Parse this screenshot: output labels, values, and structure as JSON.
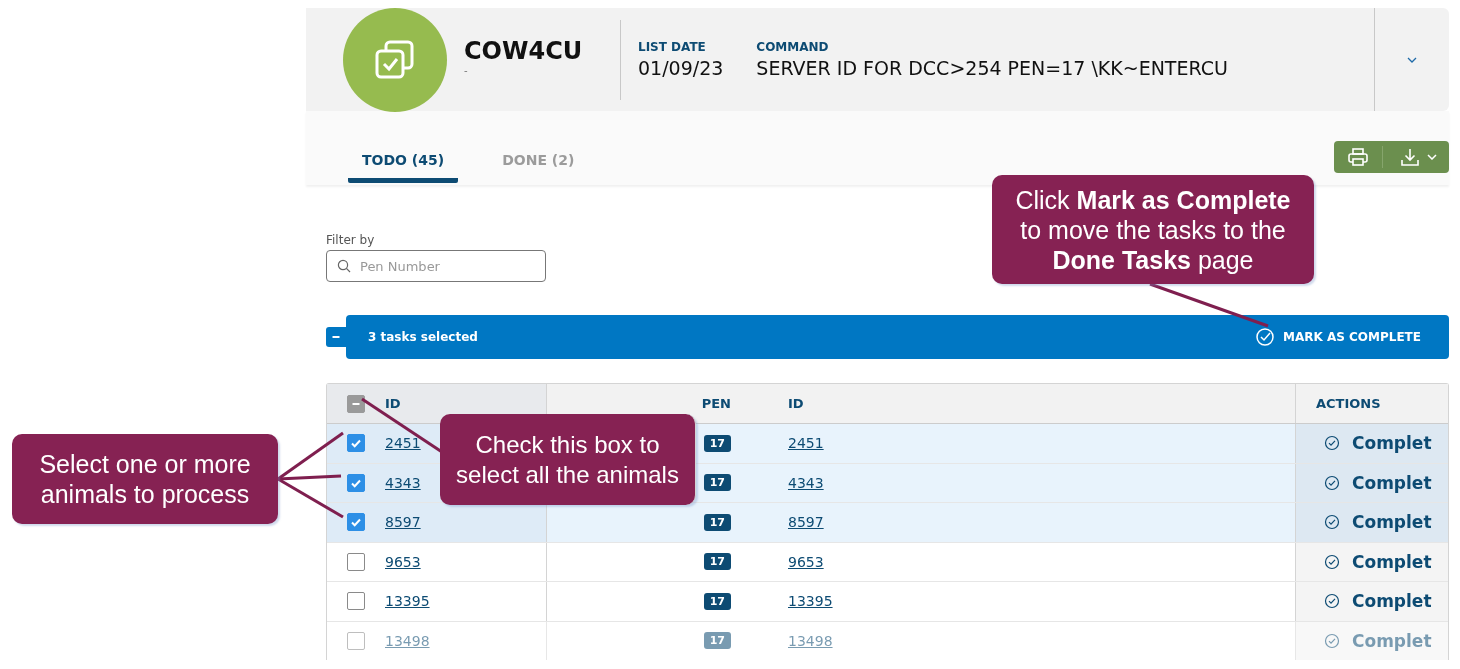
{
  "header": {
    "title": "COW4CU",
    "subtitle": "-",
    "fields": [
      {
        "label": "LIST DATE",
        "value": "01/09/23"
      },
      {
        "label": "COMMAND",
        "value": "SERVER ID FOR DCC>254 PEN=17 \\KK~ENTERCU"
      }
    ]
  },
  "tabs": [
    {
      "label": "TODO (45)",
      "selected": true
    },
    {
      "label": "DONE (2)",
      "selected": false
    }
  ],
  "filter": {
    "label": "Filter by",
    "placeholder": "Pen Number"
  },
  "selection_bar": {
    "text": "3 tasks selected",
    "action": "MARK AS COMPLETE"
  },
  "table": {
    "select_all_indeterminate": true,
    "columns": [
      "ID",
      "PEN",
      "ID",
      "ACTIONS"
    ],
    "rows": [
      {
        "checked": true,
        "id": "2451",
        "pen": "17",
        "id_2": "2451",
        "action": "Complet"
      },
      {
        "checked": true,
        "id": "4343",
        "pen": "17",
        "id_2": "4343",
        "action": "Complet"
      },
      {
        "checked": true,
        "id": "8597",
        "pen": "17",
        "id_2": "8597",
        "action": "Complet"
      },
      {
        "checked": false,
        "id": "9653",
        "pen": "17",
        "id_2": "9653",
        "action": "Complet"
      },
      {
        "checked": false,
        "id": "13395",
        "pen": "17",
        "id_2": "13395",
        "action": "Complet"
      },
      {
        "checked": false,
        "id": "13498",
        "pen": "17",
        "id_2": "13498",
        "action": "Complet"
      }
    ]
  },
  "callouts": [
    {
      "text": "Select one or more animals to process"
    },
    {
      "text": "Check this box to select all the animals"
    },
    {
      "text": "Click **Mark as Complete** to move the tasks to the **Done Tasks** page"
    }
  ]
}
